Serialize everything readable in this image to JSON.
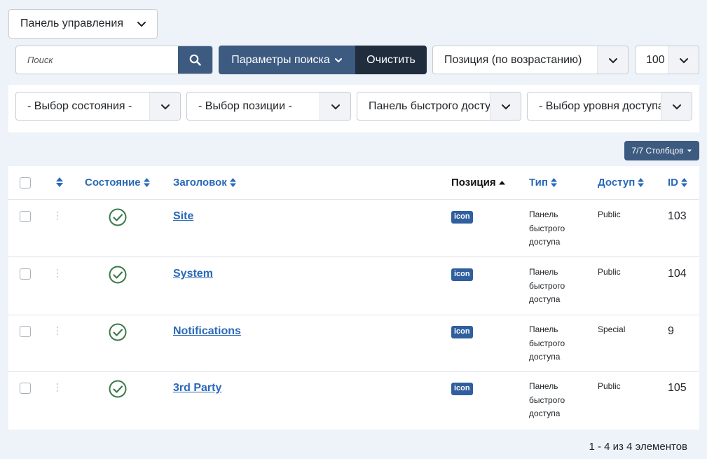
{
  "panel_select": {
    "value": "Панель управления"
  },
  "search": {
    "placeholder": "Поиск",
    "value": ""
  },
  "toolbar": {
    "params_label": "Параметры поиска",
    "clear_label": "Очистить"
  },
  "ordering_select": {
    "value": "Позиция (по возрастанию)"
  },
  "limit_select": {
    "value": "100"
  },
  "filters": {
    "state": "- Выбор состояния -",
    "position": "- Выбор позиции -",
    "module": "Панель быстрого доступа",
    "access": "- Выбор уровня доступа -"
  },
  "columns_button": {
    "label": "7/7 Столбцов"
  },
  "table": {
    "headers": {
      "status": "Состояние",
      "title": "Заголовок",
      "position": "Позиция",
      "type": "Тип",
      "access": "Доступ",
      "id": "ID"
    },
    "rows": [
      {
        "title": "Site",
        "position_badge": "icon",
        "type": "Панель быстрого доступа",
        "access": "Public",
        "id": "103"
      },
      {
        "title": "System",
        "position_badge": "icon",
        "type": "Панель быстрого доступа",
        "access": "Public",
        "id": "104"
      },
      {
        "title": "Notifications",
        "position_badge": "icon",
        "type": "Панель быстрого доступа",
        "access": "Special",
        "id": "9"
      },
      {
        "title": "3rd Party",
        "position_badge": "icon",
        "type": "Панель быстрого доступа",
        "access": "Public",
        "id": "105"
      }
    ]
  },
  "pagination": {
    "info": "1 - 4 из 4 элементов"
  },
  "colors": {
    "primary": "#3d5a80",
    "dark": "#1f2d3d",
    "link": "#2a69b8",
    "badge": "#2f5f9e",
    "published": "#3c7a4a",
    "background": "#eef2f9"
  }
}
